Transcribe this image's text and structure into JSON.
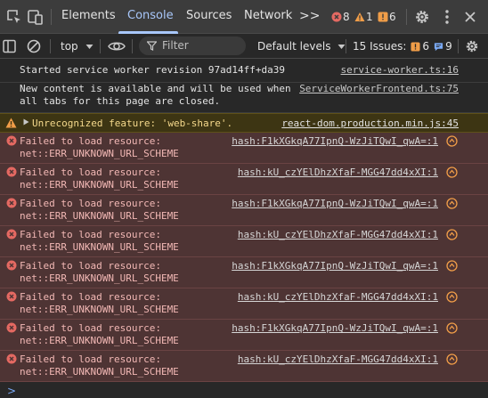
{
  "tabs": {
    "elements": "Elements",
    "console": "Console",
    "sources": "Sources",
    "network": "Network",
    "more": ">>"
  },
  "counters": {
    "errors": "8",
    "warnings": "1",
    "issues": "6"
  },
  "toolbar": {
    "context": "top",
    "filter_placeholder": "Filter",
    "levels": "Default levels",
    "issues_label": "15 Issues:",
    "issues_orange": "6",
    "issues_blue": "9"
  },
  "messages": {
    "info1": {
      "text": "Started service worker revision 97ad14ff+da39",
      "source": "service-worker.ts:16"
    },
    "info2": {
      "text": "New content is available and will be used when\nall tabs for this page are closed.",
      "source": "ServiceWorkerFrontend.ts:75"
    },
    "warn1": {
      "text": "Unrecognized feature: 'web-share'.",
      "source": "react-dom.production.min.js:45"
    },
    "errors": [
      {
        "text": "Failed to load resource:\nnet::ERR_UNKNOWN_URL_SCHEME",
        "source": "hash:F1kXGkqA77IpnQ-WzJiTQwI_qwA=:1"
      },
      {
        "text": "Failed to load resource:\nnet::ERR_UNKNOWN_URL_SCHEME",
        "source": "hash:kU_czYElDhzXfaF-MGG47dd4xXI:1"
      },
      {
        "text": "Failed to load resource:\nnet::ERR_UNKNOWN_URL_SCHEME",
        "source": "hash:F1kXGkqA77IpnQ-WzJiTQwI_qwA=:1"
      },
      {
        "text": "Failed to load resource:\nnet::ERR_UNKNOWN_URL_SCHEME",
        "source": "hash:kU_czYElDhzXfaF-MGG47dd4xXI:1"
      },
      {
        "text": "Failed to load resource:\nnet::ERR_UNKNOWN_URL_SCHEME",
        "source": "hash:F1kXGkqA77IpnQ-WzJiTQwI_qwA=:1"
      },
      {
        "text": "Failed to load resource:\nnet::ERR_UNKNOWN_URL_SCHEME",
        "source": "hash:kU_czYElDhzXfaF-MGG47dd4xXI:1"
      },
      {
        "text": "Failed to load resource:\nnet::ERR_UNKNOWN_URL_SCHEME",
        "source": "hash:F1kXGkqA77IpnQ-WzJiTQwI_qwA=:1"
      },
      {
        "text": "Failed to load resource:\nnet::ERR_UNKNOWN_URL_SCHEME",
        "source": "hash:kU_czYElDhzXfaF-MGG47dd4xXI:1"
      }
    ]
  },
  "prompt": ">",
  "colors": {
    "accent": "#a8c7fa",
    "error_bg": "#4e3434",
    "error_text": "#f2b8b5",
    "warning_bg": "#3d3513",
    "warning_text": "#f5d98c"
  }
}
